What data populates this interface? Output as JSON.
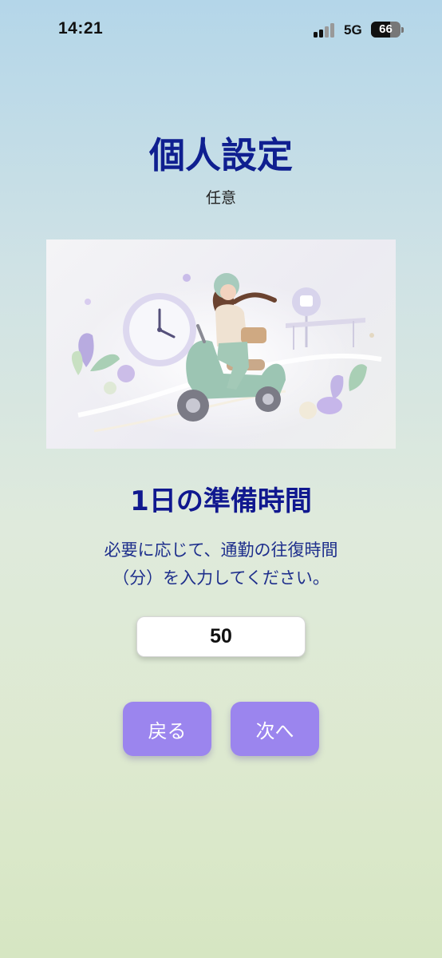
{
  "status_bar": {
    "time": "14:21",
    "network": "5G",
    "battery": "66",
    "battery_level": 0.66
  },
  "header": {
    "title": "個人設定",
    "subtitle": "任意"
  },
  "illustration": {
    "icon": "woman-on-scooter-with-clock-illustration",
    "colors": {
      "scooter": "#9cc5b3",
      "clock": "#dcd6ee",
      "accent": "#b5a2e4"
    }
  },
  "prep_time": {
    "title": "1日の準備時間",
    "description_line1": "必要に応じて、通勤の往復時間",
    "description_line2": "（分）を入力してください。",
    "value": "50"
  },
  "buttons": {
    "back_label": "戻る",
    "next_label": "次へ"
  },
  "colors": {
    "title": "#0f1f90",
    "button": "#9b85ee"
  }
}
